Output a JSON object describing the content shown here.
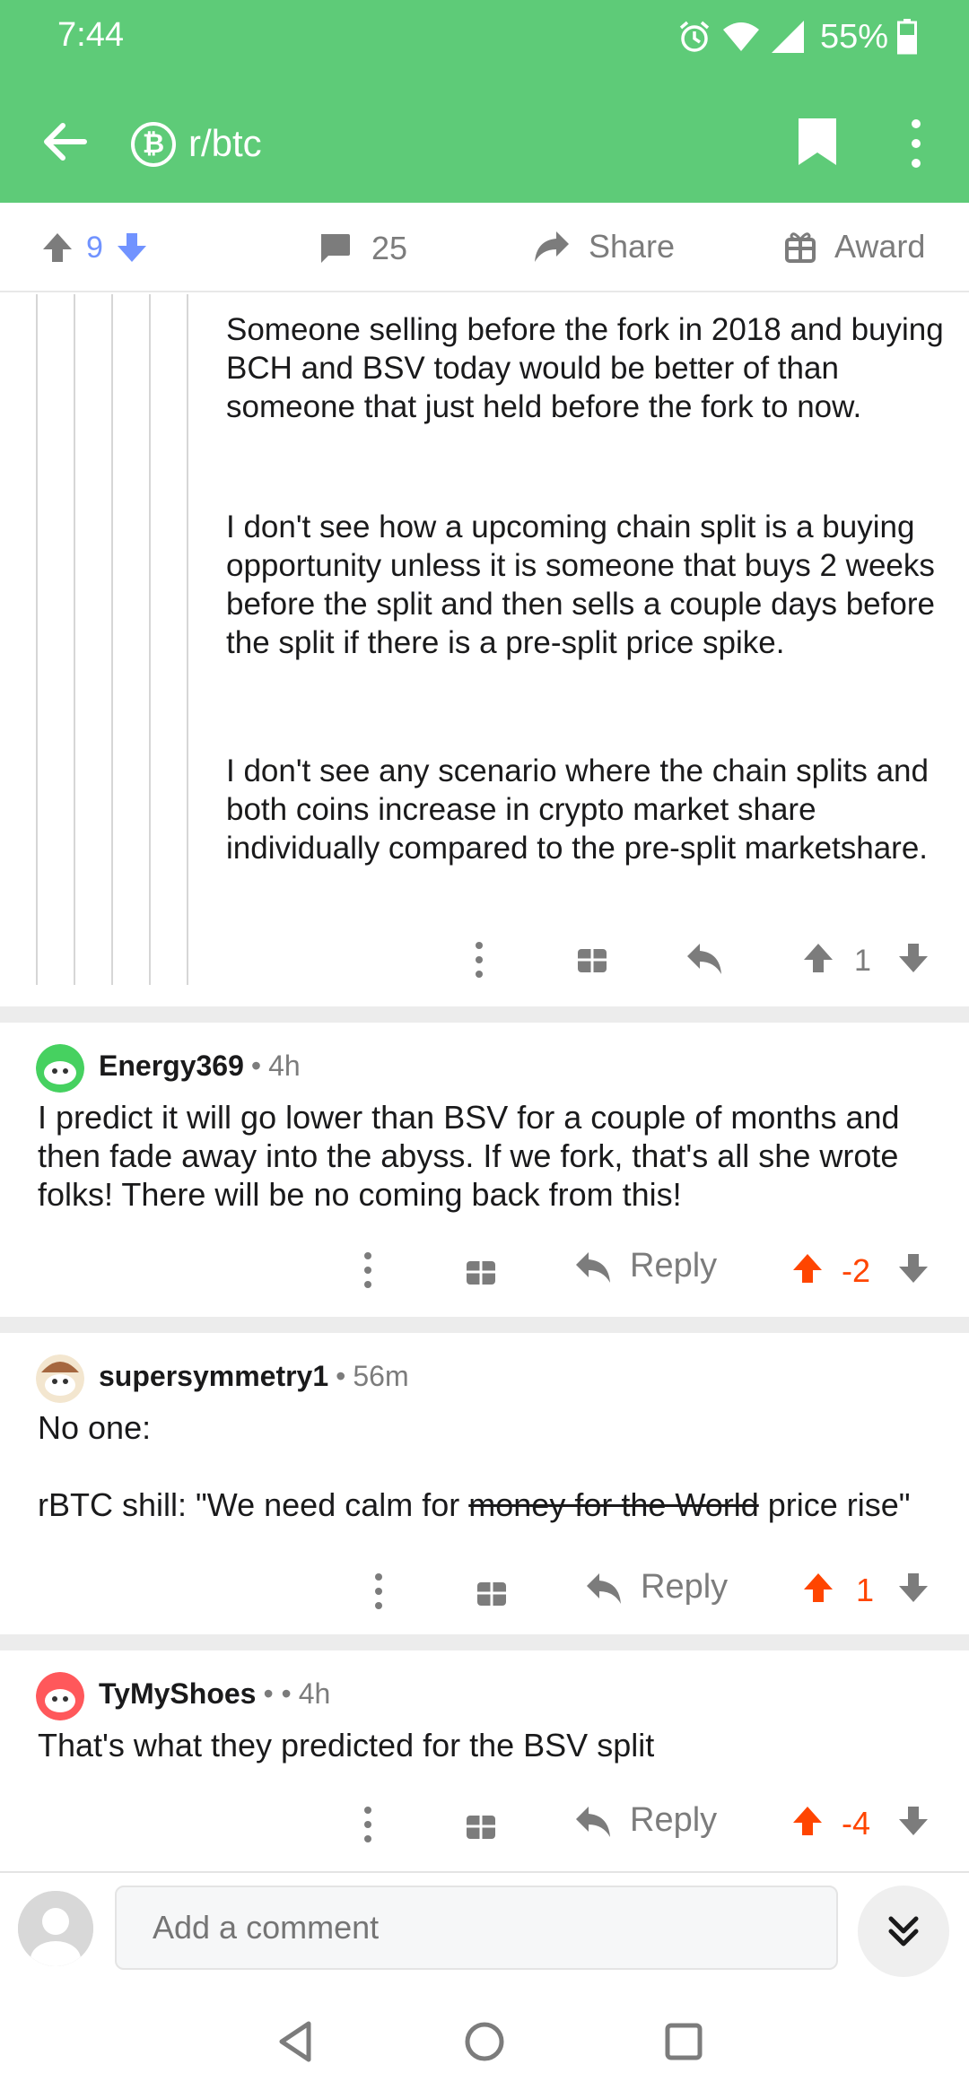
{
  "status_bar": {
    "time": "7:44",
    "battery": "55%"
  },
  "header": {
    "subreddit": "r/btc",
    "subreddit_icon": "bitcoin-icon",
    "back_icon": "arrow-left-icon",
    "bookmark_icon": "bookmark-icon",
    "more_icon": "more-vertical-icon",
    "bg_color": "#5ecb78"
  },
  "post_bar": {
    "score": "9",
    "comments": "25",
    "share": "Share",
    "award": "Award"
  },
  "nested_comment": {
    "paragraphs": [
      "Someone selling before the fork in 2018 and buying BCH and BSV today would be better of than someone that just held before the fork to now.",
      "I don't see how a upcoming chain split is a buying opportunity unless it is someone that buys 2 weeks before the split and then sells a couple days before the split if there is a pre-split price spike.",
      "I don't see any scenario where the chain splits and both coins increase in crypto market share individually compared to the pre-split marketshare."
    ],
    "score": "1"
  },
  "comments": [
    {
      "author": "Energy369",
      "age": "4h",
      "sep": "•",
      "body": "I predict it will go lower than BSV for a couple of months and then fade away into the abyss. If we fork, that's all she wrote folks! There will be no coming back from this!",
      "reply": "Reply",
      "score": "-2"
    },
    {
      "author": "supersymmetry1",
      "age": "56m",
      "sep": "•",
      "body_line1": "No one:",
      "body_line2_pre": "rBTC shill: \"We need calm for ",
      "body_line2_strike": "money for the World",
      "body_line2_post": " price rise\"",
      "reply": "Reply",
      "score": "1"
    },
    {
      "author": "TyMyShoes",
      "age": "4h",
      "sep": "•  •",
      "body": "That's what they predicted for the BSV split",
      "reply": "Reply",
      "score": "-4"
    }
  ],
  "composer": {
    "placeholder": "Add a comment"
  },
  "colors": {
    "upvote_orange": "#ff4500",
    "downvote_blue": "#7193ff",
    "muted": "#7c7c7c"
  }
}
